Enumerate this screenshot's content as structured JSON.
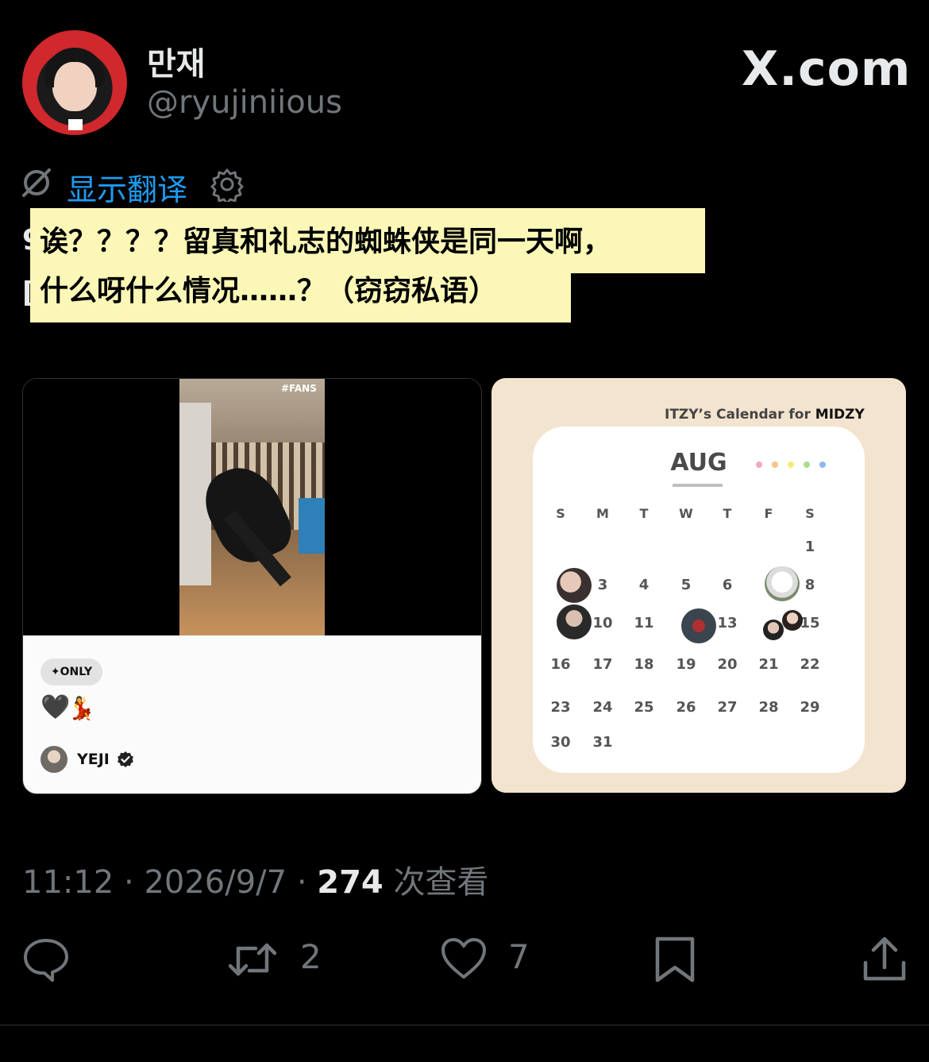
{
  "author": {
    "display_name": "만재",
    "handle": "@ryujiniious"
  },
  "brand": "X.com",
  "translate": {
    "label": "显示翻译"
  },
  "tweet": {
    "line1": "诶？？？？留真和礼志的蜘蛛侠是同一天啊，",
    "line2": "什么呀什么情况……？（窃窃私语）",
    "peek1": "9",
    "peek2": "[]"
  },
  "media_left": {
    "fans_tag": "#FANS",
    "only_badge": "✦ONLY",
    "emoji_heart": "🖤",
    "emoji_dancer": "💃",
    "author_name": "YEJI"
  },
  "media_right": {
    "header_prefix": "ITZY’s Calendar for",
    "header_strong": "MIDZY",
    "month": "AUG",
    "weekdays": [
      "S",
      "M",
      "T",
      "W",
      "T",
      "F",
      "S"
    ],
    "dot_colors": [
      "#f4a6c0",
      "#f7c48a",
      "#f6ea7a",
      "#a8df8a",
      "#8fb8f0"
    ]
  },
  "meta": {
    "time": "11:12",
    "date": "2026/9/7",
    "views_count": "274",
    "views_label": "次查看"
  },
  "actions": {
    "retweets": "2",
    "likes": "7"
  },
  "icons": [
    "avatar",
    "no-translate-icon",
    "settings-icon",
    "verified-icon",
    "reply-icon",
    "retweet-icon",
    "like-icon",
    "bookmark-icon",
    "share-icon"
  ]
}
